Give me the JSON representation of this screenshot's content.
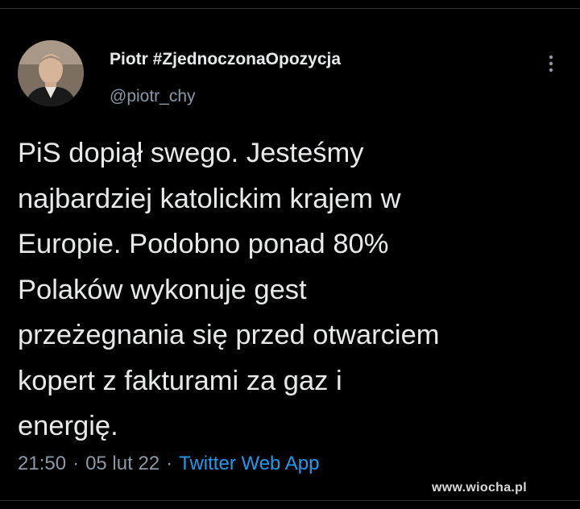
{
  "author": {
    "display_name": "Piotr #ZjednoczonaOpozycja",
    "handle": "@piotr_chy",
    "avatar_icon": "profile-photo"
  },
  "more_icon": "more-options-icon",
  "tweet": {
    "lines": [
      "PiS dopiął swego. Jesteśmy",
      "najbardziej katolickim krajem w",
      "Europie. Podobno ponad 80%",
      "Polaków wykonuje gest",
      "przeżegnania się przed otwarciem",
      "kopert z fakturami za gaz i",
      "energię."
    ]
  },
  "meta": {
    "time": "21:50",
    "date": "05 lut 22",
    "separator": "·",
    "source": "Twitter Web App"
  },
  "watermark": "www.wiocha.pl",
  "colors": {
    "background": "#000000",
    "text": "#e7e9ea",
    "secondary": "#8b98a5",
    "link": "#1d9bf0"
  }
}
